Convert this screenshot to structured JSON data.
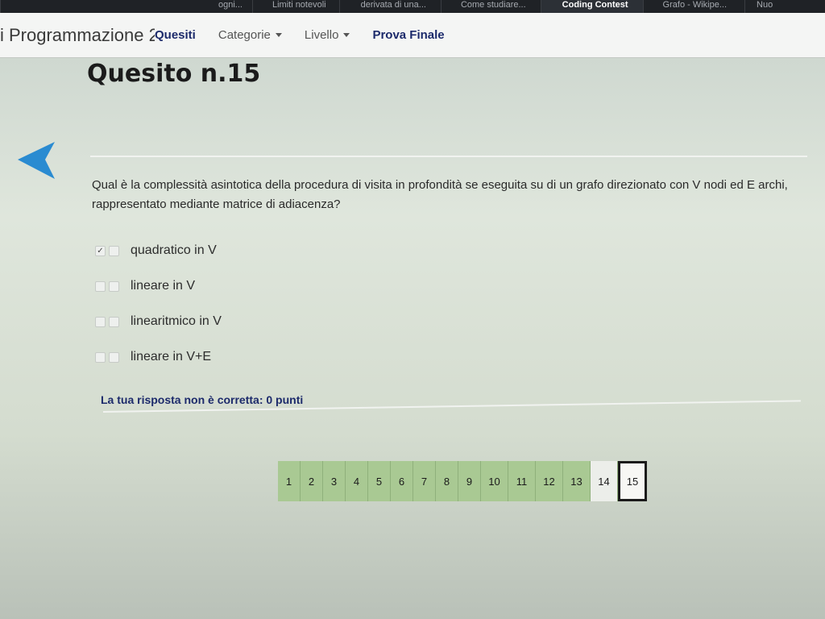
{
  "browser": {
    "bookmarks": [
      {
        "label": "ogni...",
        "active": false
      },
      {
        "label": "Limiti notevoli",
        "active": false
      },
      {
        "label": "derivata di una...",
        "active": false
      },
      {
        "label": "Come studiare...",
        "active": false
      },
      {
        "label": "Coding Contest",
        "active": true
      },
      {
        "label": "Grafo - Wikipe...",
        "active": false
      },
      {
        "label": "Nuo",
        "active": false
      }
    ]
  },
  "navbar": {
    "site_title": "i Programmazione 2",
    "links": [
      {
        "label": "Quesiti",
        "bold": true,
        "dropdown": false
      },
      {
        "label": "Categorie",
        "bold": false,
        "dropdown": true
      },
      {
        "label": "Livello",
        "bold": false,
        "dropdown": true
      },
      {
        "label": "Prova Finale",
        "bold": true,
        "dropdown": false
      }
    ]
  },
  "main": {
    "title": "Quesito n.15",
    "question": "Qual è la complessità asintotica della procedura di visita in profondità se eseguita su di un grafo direzionato con V nodi ed E archi, rappresentato mediante matrice di adiacenza?",
    "answers": [
      {
        "label": "quadratico in V",
        "checked": true
      },
      {
        "label": "lineare in V",
        "checked": false
      },
      {
        "label": "linearitmico in V",
        "checked": false
      },
      {
        "label": "lineare in V+E",
        "checked": false
      }
    ],
    "feedback": "La tua risposta non è corretta: 0 punti"
  },
  "pager": {
    "pages": [
      {
        "label": "1",
        "state": "done"
      },
      {
        "label": "2",
        "state": "done"
      },
      {
        "label": "3",
        "state": "done"
      },
      {
        "label": "4",
        "state": "done"
      },
      {
        "label": "5",
        "state": "done"
      },
      {
        "label": "6",
        "state": "done"
      },
      {
        "label": "7",
        "state": "done"
      },
      {
        "label": "8",
        "state": "done"
      },
      {
        "label": "9",
        "state": "done"
      },
      {
        "label": "10",
        "state": "done"
      },
      {
        "label": "11",
        "state": "done"
      },
      {
        "label": "12",
        "state": "done"
      },
      {
        "label": "13",
        "state": "done"
      },
      {
        "label": "14",
        "state": "light"
      },
      {
        "label": "15",
        "state": "current"
      }
    ]
  },
  "colors": {
    "navy": "#1c2a6b",
    "arrow_blue": "#2a8bd1",
    "page_green": "#a9c993"
  }
}
